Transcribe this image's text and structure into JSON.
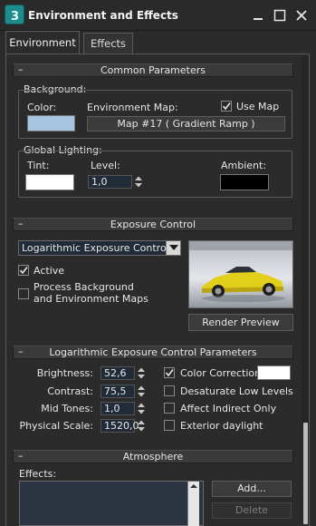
{
  "window": {
    "title": "Environment and Effects",
    "icon": "3ds-max-icon",
    "controls": [
      "minimize-icon",
      "maximize-icon",
      "close-icon"
    ]
  },
  "tabs": [
    {
      "label": "Environment",
      "active": true
    },
    {
      "label": "Effects",
      "active": false
    }
  ],
  "common": {
    "title": "Common Parameters",
    "background_label": "Background:",
    "color_label": "Color:",
    "color_value": "#a8c4e0",
    "env_map_label": "Environment Map:",
    "use_map_label": "Use Map",
    "use_map_checked": true,
    "map_button": "Map #17  ( Gradient Ramp )",
    "global_lighting_label": "Global Lighting:",
    "tint_label": "Tint:",
    "tint_value": "#ffffff",
    "level_label": "Level:",
    "level_value": "1,0",
    "ambient_label": "Ambient:",
    "ambient_value": "#000000"
  },
  "exposure": {
    "title": "Exposure Control",
    "dropdown_value": "Logarithmic Exposure Control",
    "active_label": "Active",
    "active_checked": true,
    "process_bg_line1": "Process Background",
    "process_bg_line2": "and Environment Maps",
    "process_bg_checked": false,
    "render_preview_button": "Render Preview"
  },
  "log_params": {
    "title": "Logarithmic Exposure Control Parameters",
    "brightness_label": "Brightness:",
    "brightness_value": "52,6",
    "contrast_label": "Contrast:",
    "contrast_value": "75,5",
    "midtones_label": "Mid Tones:",
    "midtones_value": "1,0",
    "physical_scale_label": "Physical Scale:",
    "physical_scale_value": "1520,0",
    "color_correction_label": "Color Correction:",
    "color_correction_checked": true,
    "color_correction_value": "#ffffff",
    "desaturate_label": "Desaturate Low Levels",
    "desaturate_checked": false,
    "affect_indirect_label": "Affect Indirect Only",
    "affect_indirect_checked": false,
    "exterior_daylight_label": "Exterior daylight",
    "exterior_daylight_checked": false
  },
  "atmosphere": {
    "title": "Atmosphere",
    "effects_label": "Effects:",
    "add_button": "Add...",
    "delete_button": "Delete"
  },
  "colors": {
    "panel_bg": "#2b2b2b",
    "field_bg": "#222c38",
    "app_icon": "#1e8c8c"
  }
}
